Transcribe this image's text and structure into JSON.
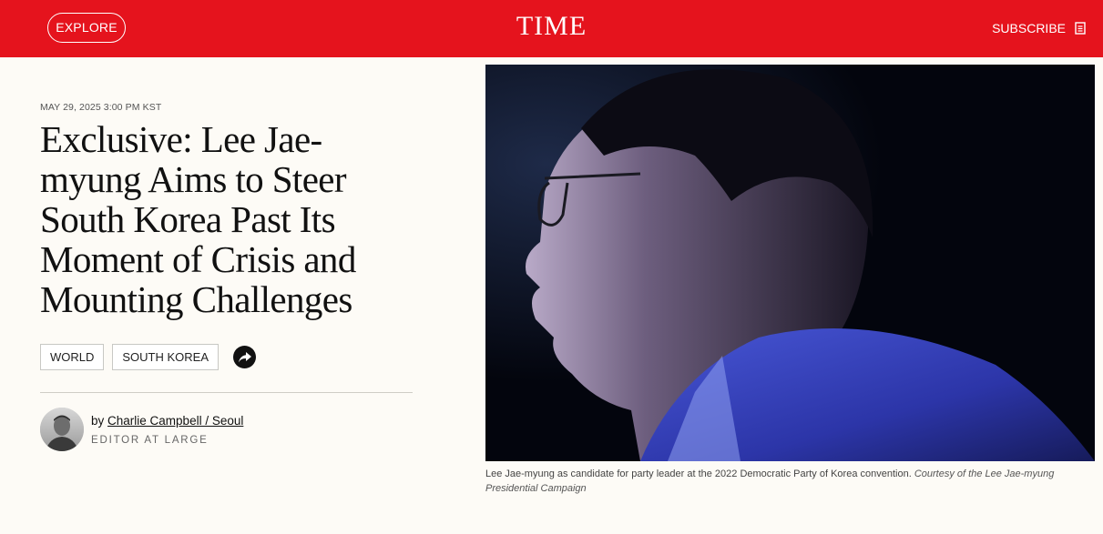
{
  "header": {
    "explore_label": "EXPLORE",
    "logo": "TIME",
    "subscribe_label": "SUBSCRIBE",
    "brand_color": "#e5131d"
  },
  "article": {
    "dateline": "MAY 29, 2025 3:00 PM KST",
    "headline": "Exclusive: Lee Jae-myung Aims to Steer South Korea Past Its Moment of Crisis and Mounting Challenges",
    "tags": [
      "WORLD",
      "SOUTH KOREA"
    ],
    "byline_prefix": "by",
    "author": "Charlie Campbell / Seoul",
    "author_role": "EDITOR AT LARGE"
  },
  "image": {
    "caption": "Lee Jae-myung as candidate for party leader at the 2022 Democratic Party of Korea convention.",
    "credit": "Courtesy of the Lee Jae-myung Presidential Campaign"
  },
  "icons": {
    "share": "share-arrow-icon",
    "subscribe": "document-icon"
  }
}
